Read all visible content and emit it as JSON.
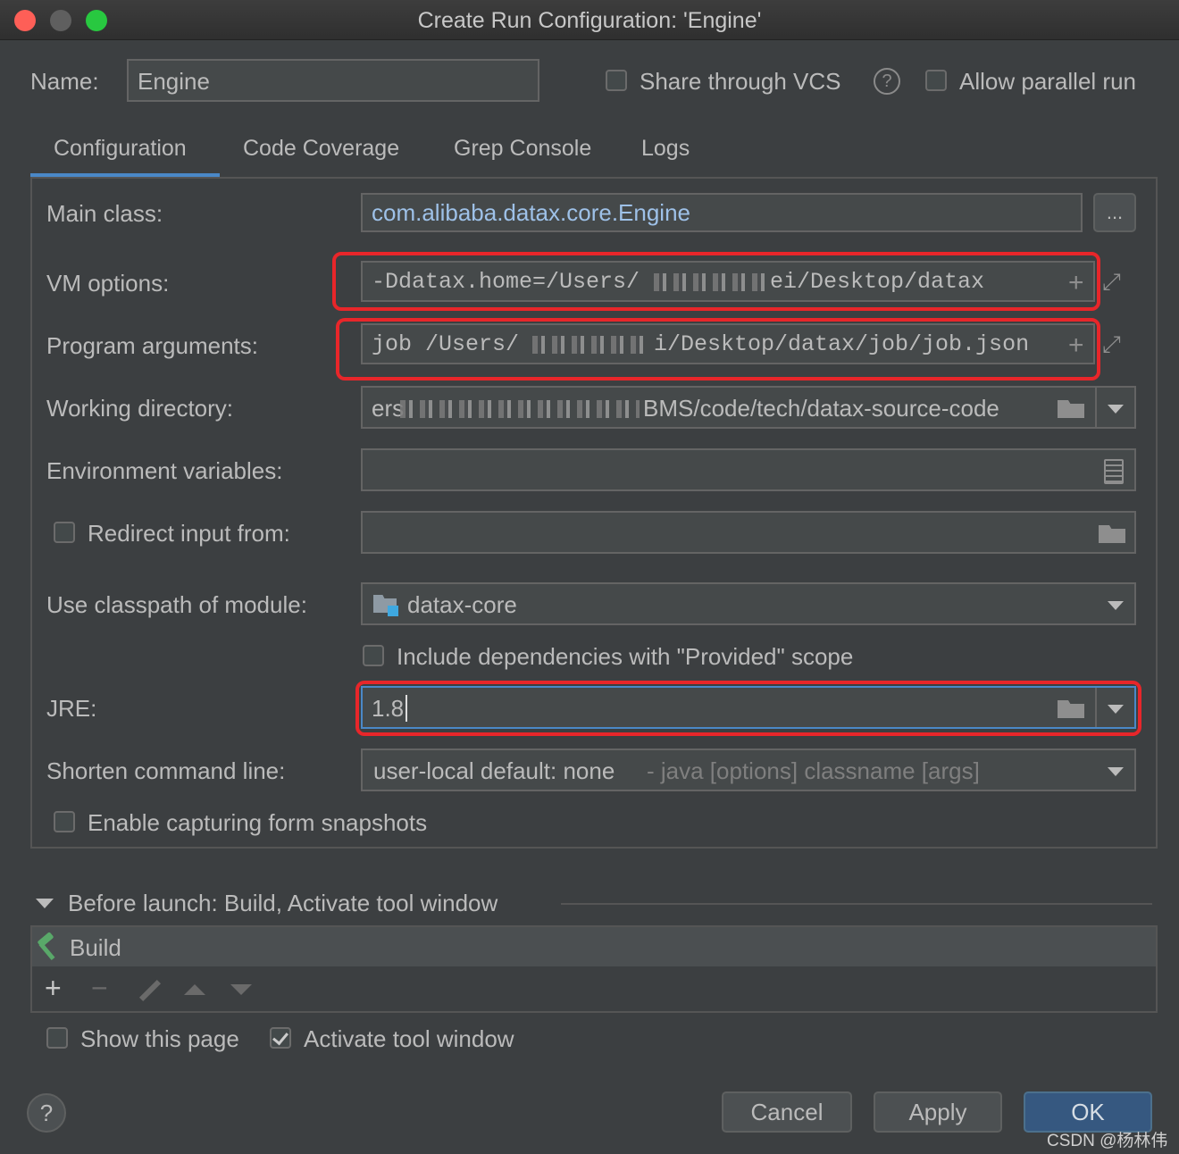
{
  "window": {
    "title": "Create Run Configuration: 'Engine'"
  },
  "header": {
    "name_label": "Name:",
    "name_value": "Engine",
    "share_vcs_label": "Share through VCS",
    "share_vcs_checked": false,
    "help_glyph": "?",
    "allow_parallel_label": "Allow parallel run",
    "allow_parallel_checked": false
  },
  "tabs": [
    {
      "label": "Configuration",
      "active": true
    },
    {
      "label": "Code Coverage",
      "active": false
    },
    {
      "label": "Grep Console",
      "active": false
    },
    {
      "label": "Logs",
      "active": false
    }
  ],
  "config": {
    "main_class": {
      "label": "Main class:",
      "value": "com.alibaba.datax.core.Engine",
      "browse": "..."
    },
    "vm_options": {
      "label": "VM options:",
      "value_start": "-Ddatax.home=/Users/",
      "value_end": "ei/Desktop/datax"
    },
    "program_args": {
      "label": "Program arguments:",
      "value_start": "job /Users/",
      "value_end": "i/Desktop/datax/job/job.json"
    },
    "working_dir": {
      "label": "Working directory:",
      "value_start": "ers",
      "value_end": "BMS/code/tech/datax-source-code"
    },
    "env_vars": {
      "label": "Environment variables:",
      "value": ""
    },
    "redirect_input": {
      "label": "Redirect input from:",
      "checked": false,
      "value": ""
    },
    "classpath_module": {
      "label": "Use classpath of module:",
      "value": "datax-core"
    },
    "include_provided": {
      "label": "Include dependencies with \"Provided\" scope",
      "checked": false
    },
    "jre": {
      "label": "JRE:",
      "value": "1.8"
    },
    "shorten_cmd": {
      "label": "Shorten command line:",
      "value": "user-local default: none",
      "hint": " - java [options] classname [args]"
    },
    "capture_snapshots": {
      "label": "Enable capturing form snapshots",
      "checked": false
    }
  },
  "before_launch": {
    "title": "Before launch: Build, Activate tool window",
    "items": [
      "Build"
    ],
    "toolbar": {
      "add": "+",
      "remove": "−"
    }
  },
  "footer": {
    "show_page_label": "Show this page",
    "show_page_checked": false,
    "activate_tool_label": "Activate tool window",
    "activate_tool_checked": true,
    "help": "?",
    "cancel": "Cancel",
    "apply": "Apply",
    "ok": "OK"
  },
  "watermark": "CSDN @杨林伟",
  "colors": {
    "background": "#3c3f41",
    "field": "#45494a",
    "accent": "#4a88c7",
    "highlight_box": "#e8262a",
    "ok_button": "#365880"
  }
}
